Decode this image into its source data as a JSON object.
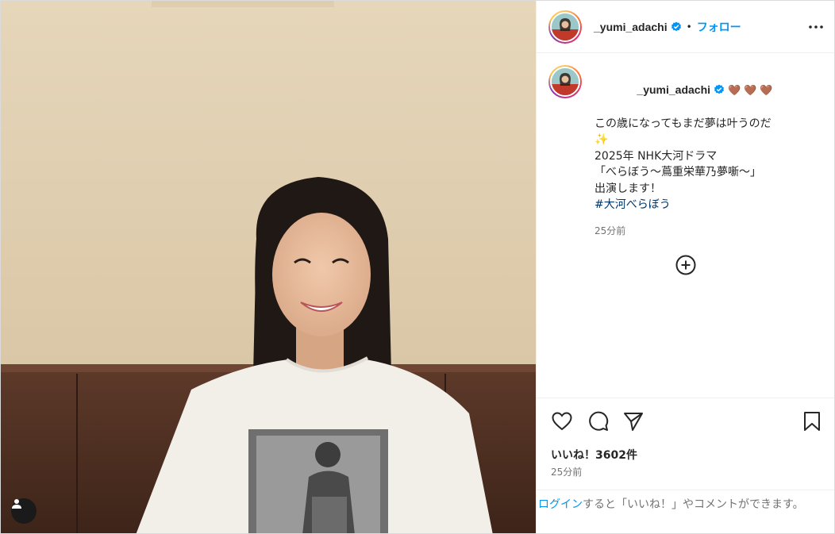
{
  "post": {
    "username": "_yumi_adachi",
    "header": {
      "separator": "•",
      "follow_label": "フォロー"
    },
    "caption": {
      "hearts": [
        "🤎",
        "🤎",
        "🤎"
      ],
      "lines": [
        "この歳になってもまだ夢は叶うのだ",
        "✨",
        "",
        "2025年 NHK大河ドラマ",
        "「べらぼう〜蔦重栄華乃夢噺〜」",
        "出演します！",
        ""
      ],
      "hashtag": "#大河べらぼう",
      "time": "25分前"
    },
    "likes": "いいね！3602件",
    "post_time": "25分前",
    "login_prompt": {
      "link": "ログイン",
      "text": "すると「いいね！」やコメントができます。"
    }
  },
  "icons": {
    "verified": "verified-badge-icon",
    "more": "more-options-icon",
    "load_more": "plus-circle-icon",
    "like": "heart-icon",
    "comment": "comment-icon",
    "share": "send-icon",
    "save": "bookmark-icon",
    "tag": "user-tag-icon"
  },
  "colors": {
    "accent": "#0095f6",
    "hashtag": "#00376b",
    "muted": "#737373",
    "text": "#262626"
  }
}
